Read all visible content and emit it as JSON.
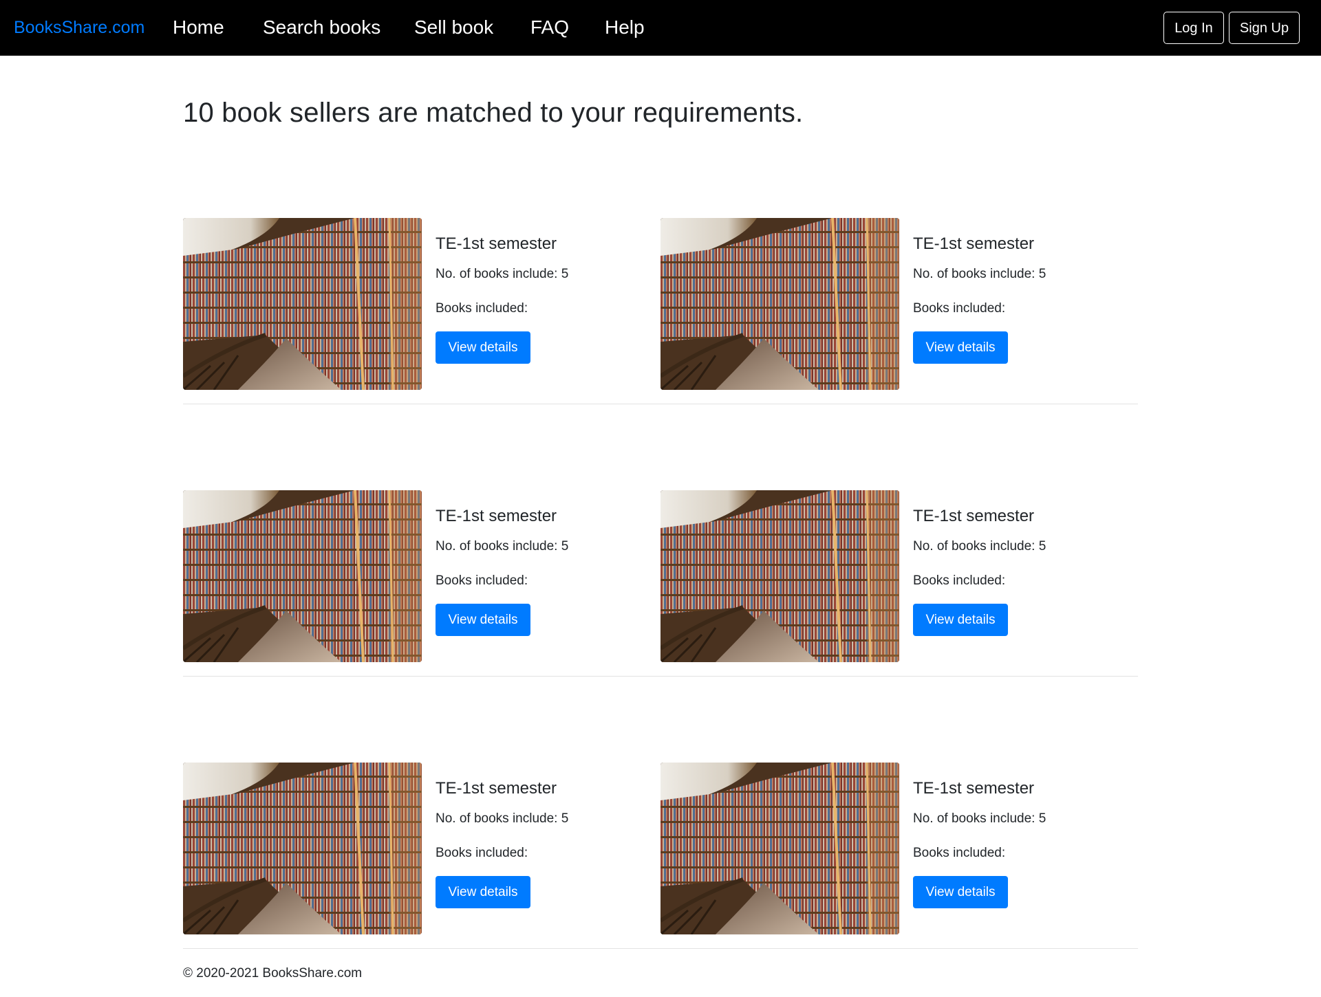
{
  "navbar": {
    "brand": "BooksShare.com",
    "links": [
      "Home",
      "Search books",
      "Sell book",
      "FAQ",
      "Help"
    ],
    "login_label": "Log In",
    "signup_label": "Sign Up"
  },
  "main": {
    "heading": "10 book sellers are matched to your requirements.",
    "listings": [
      {
        "title": "TE-1st semester",
        "count_text": "No. of books include: 5",
        "included_text": "Books included:",
        "button_label": "View details"
      },
      {
        "title": "TE-1st semester",
        "count_text": "No. of books include: 5",
        "included_text": "Books included:",
        "button_label": "View details"
      },
      {
        "title": "TE-1st semester",
        "count_text": "No. of books include: 5",
        "included_text": "Books included:",
        "button_label": "View details"
      },
      {
        "title": "TE-1st semester",
        "count_text": "No. of books include: 5",
        "included_text": "Books included:",
        "button_label": "View details"
      },
      {
        "title": "TE-1st semester",
        "count_text": "No. of books include: 5",
        "included_text": "Books included:",
        "button_label": "View details"
      },
      {
        "title": "TE-1st semester",
        "count_text": "No. of books include: 5",
        "included_text": "Books included:",
        "button_label": "View details"
      }
    ]
  },
  "footer": {
    "copyright": "© 2020-2021 BooksShare.com"
  },
  "colors": {
    "navbar_bg": "#000000",
    "brand": "#007bff",
    "primary_button": "#007bff"
  },
  "icons": {
    "listing_image": "library-bookshelves-photo"
  }
}
